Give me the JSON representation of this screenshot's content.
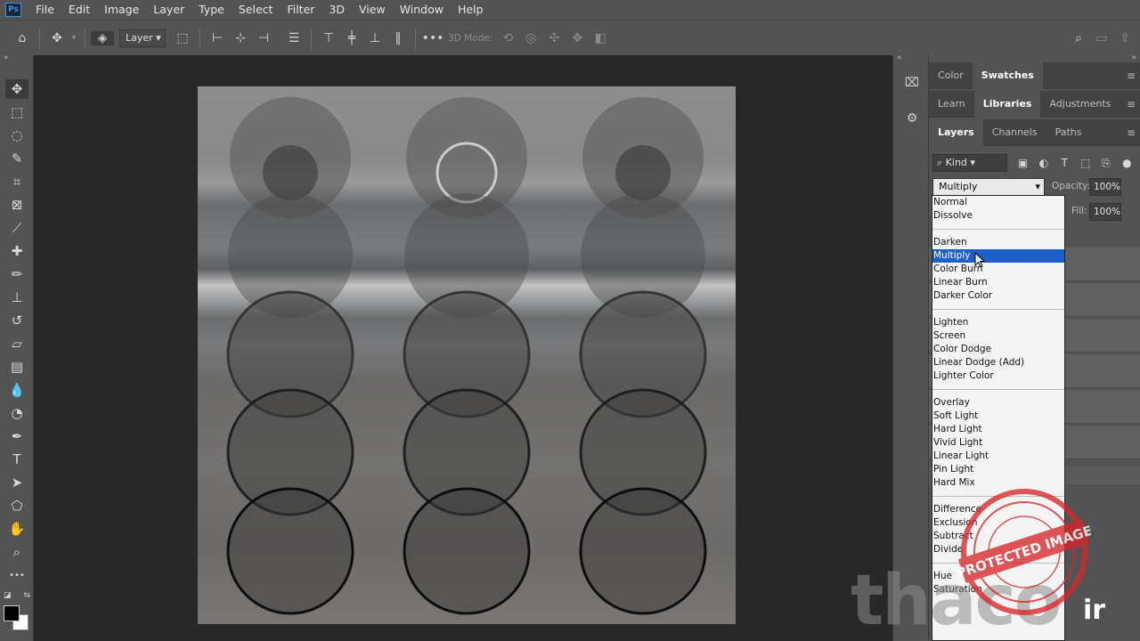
{
  "app": {
    "logo": "Ps"
  },
  "menu": [
    "File",
    "Edit",
    "Image",
    "Layer",
    "Type",
    "Select",
    "Filter",
    "3D",
    "View",
    "Window",
    "Help"
  ],
  "options_bar": {
    "auto_select_target": "Layer",
    "mode_3d_label": "3D Mode:"
  },
  "tools": [
    "move-icon",
    "marquee-icon",
    "lasso-icon",
    "quick-select-icon",
    "crop-icon",
    "frame-icon",
    "eyedropper-icon",
    "healing-icon",
    "brush-icon",
    "stamp-icon",
    "history-brush-icon",
    "eraser-icon",
    "gradient-icon",
    "blur-icon",
    "dodge-icon",
    "pen-icon",
    "type-icon",
    "path-select-icon",
    "shape-icon",
    "hand-icon",
    "zoom-icon",
    "more-icon"
  ],
  "panels": {
    "row1_tabs": [
      "Color",
      "Swatches"
    ],
    "row1_active": "Swatches",
    "row2_tabs": [
      "Learn",
      "Libraries",
      "Adjustments"
    ],
    "row2_active": "Libraries",
    "row3_tabs": [
      "Layers",
      "Channels",
      "Paths"
    ],
    "row3_active": "Layers",
    "kind_filter": "Kind",
    "blend_mode": "Multiply",
    "opacity_label": "Opacity:",
    "opacity_value": "100%",
    "fill_label": "Fill:",
    "fill_value": "100%"
  },
  "blend_modes": [
    [
      "Normal",
      "Dissolve"
    ],
    [
      "Darken",
      "Multiply",
      "Color Burn",
      "Linear Burn",
      "Darker Color"
    ],
    [
      "Lighten",
      "Screen",
      "Color Dodge",
      "Linear Dodge (Add)",
      "Lighter Color"
    ],
    [
      "Overlay",
      "Soft Light",
      "Hard Light",
      "Vivid Light",
      "Linear Light",
      "Pin Light",
      "Hard Mix"
    ],
    [
      "Difference",
      "Exclusion",
      "Subtract",
      "Divide"
    ],
    [
      "Hue",
      "Saturation"
    ]
  ],
  "selected_blend_mode": "Multiply",
  "watermark": {
    "text": "thaco",
    "suffix": "ir",
    "stamp_text": "PROTECTED IMAGE"
  },
  "colors": {
    "selection": "#1c5fc8",
    "stamp": "#d9262b"
  }
}
